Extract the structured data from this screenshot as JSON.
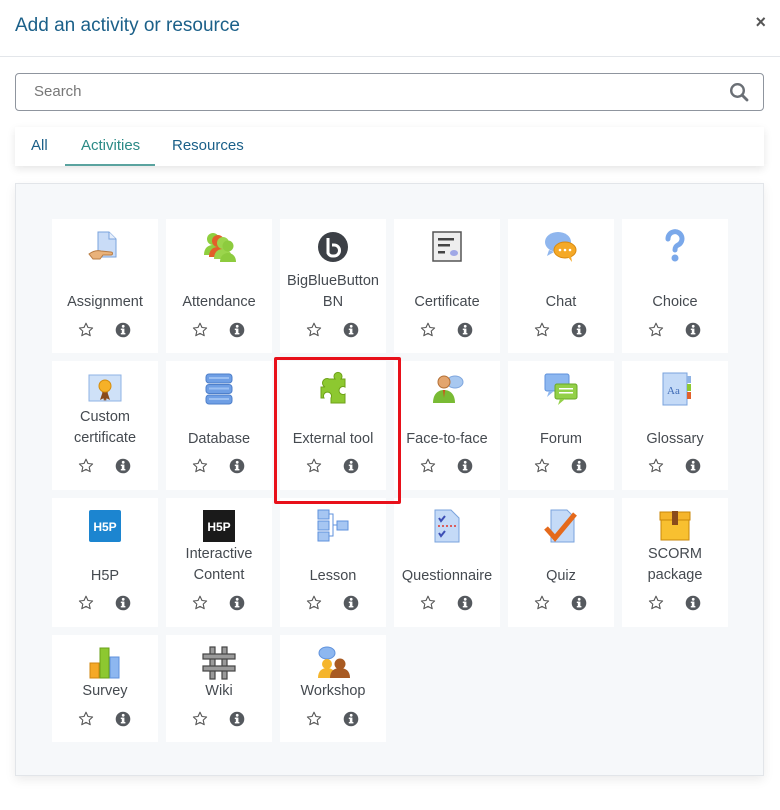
{
  "dialog": {
    "title": "Add an activity or resource",
    "close_label": "×"
  },
  "search": {
    "placeholder": "Search",
    "value": ""
  },
  "tabs": [
    {
      "label": "All",
      "active": false
    },
    {
      "label": "Activities",
      "active": true
    },
    {
      "label": "Resources",
      "active": false
    }
  ],
  "colors": {
    "accent": "#1b6089",
    "active_tab": "#2b8a86",
    "highlight": "#e8101a"
  },
  "items": [
    {
      "name": "Assignment",
      "icon": "assignment-icon"
    },
    {
      "name": "Attendance",
      "icon": "attendance-icon"
    },
    {
      "name": "BigBlueButton BN",
      "line1": "BigBlueButton",
      "line2": "BN",
      "icon": "bigbluebutton-icon"
    },
    {
      "name": "Certificate",
      "icon": "certificate-icon"
    },
    {
      "name": "Chat",
      "icon": "chat-icon"
    },
    {
      "name": "Choice",
      "icon": "choice-icon"
    },
    {
      "name": "Custom certificate",
      "line1": "Custom",
      "line2": "certificate",
      "icon": "custom-certificate-icon"
    },
    {
      "name": "Database",
      "icon": "database-icon"
    },
    {
      "name": "External tool",
      "icon": "external-tool-icon",
      "highlighted": true
    },
    {
      "name": "Face-to-face",
      "icon": "face-to-face-icon"
    },
    {
      "name": "Forum",
      "icon": "forum-icon"
    },
    {
      "name": "Glossary",
      "icon": "glossary-icon"
    },
    {
      "name": "H5P",
      "icon": "h5p-icon"
    },
    {
      "name": "Interactive Content",
      "line1": "Interactive",
      "line2": "Content",
      "icon": "interactive-content-icon"
    },
    {
      "name": "Lesson",
      "icon": "lesson-icon"
    },
    {
      "name": "Questionnaire",
      "icon": "questionnaire-icon"
    },
    {
      "name": "Quiz",
      "icon": "quiz-icon"
    },
    {
      "name": "SCORM package",
      "line1": "SCORM",
      "line2": "package",
      "icon": "scorm-icon"
    },
    {
      "name": "Survey",
      "icon": "survey-icon"
    },
    {
      "name": "Wiki",
      "icon": "wiki-icon"
    },
    {
      "name": "Workshop",
      "icon": "workshop-icon"
    }
  ],
  "h5p_text": "H5P"
}
